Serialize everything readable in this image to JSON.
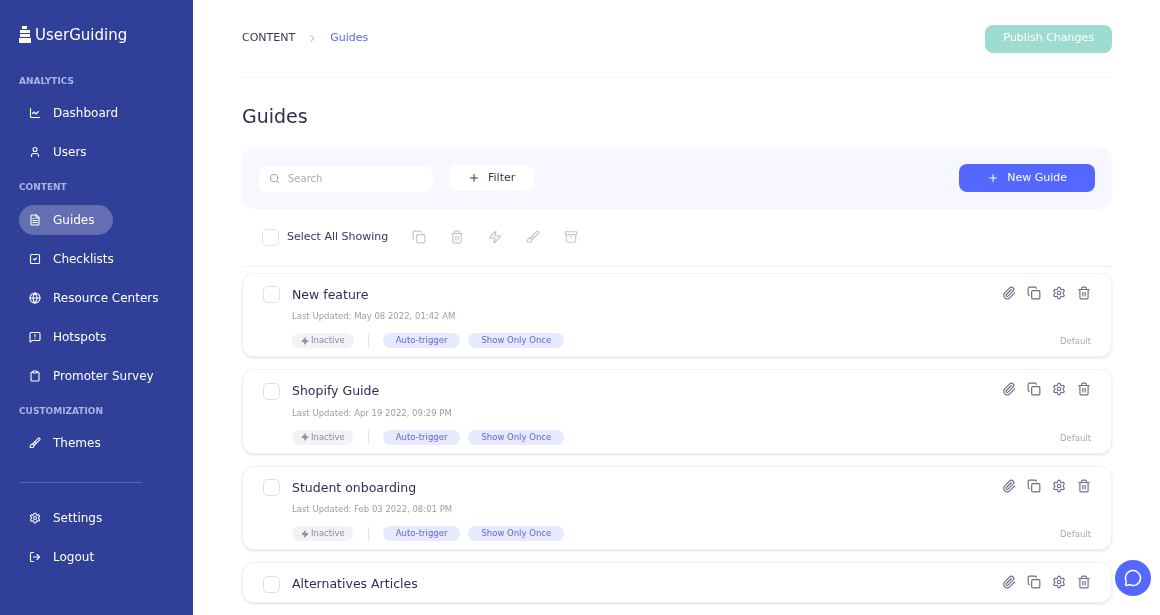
{
  "brand": "UserGuiding",
  "sidebar": {
    "sections": [
      {
        "title": "ANALYTICS",
        "items": [
          {
            "label": "Dashboard",
            "selected": false
          },
          {
            "label": "Users",
            "selected": false
          }
        ]
      },
      {
        "title": "CONTENT",
        "items": [
          {
            "label": "Guides",
            "selected": true
          },
          {
            "label": "Checklists",
            "selected": false
          },
          {
            "label": "Resource Centers",
            "selected": false
          },
          {
            "label": "Hotspots",
            "selected": false
          },
          {
            "label": "Promoter Survey",
            "selected": false
          }
        ]
      },
      {
        "title": "CUSTOMIZATION",
        "items": [
          {
            "label": "Themes",
            "selected": false
          }
        ]
      }
    ],
    "bottom_items": [
      {
        "label": "Settings",
        "selected": false
      },
      {
        "label": "Logout",
        "selected": false
      }
    ]
  },
  "breadcrumb": [
    "CONTENT",
    "Guides"
  ],
  "publish_button": {
    "label": "Publish Changes",
    "disabled": true
  },
  "page_title": "Guides",
  "search": {
    "placeholder": "Search"
  },
  "filter_button": "Filter",
  "new_button": "New Guide",
  "select_all": {
    "label": "Select All Showing",
    "checked": false
  },
  "guides": [
    {
      "name": "New feature",
      "updated": "Last Updated: May 08 2022, 01:42 AM",
      "status": "Inactive",
      "tags": [
        "Auto-trigger",
        "Show Only Once"
      ],
      "theme": "Default",
      "checked": false
    },
    {
      "name": "Shopify Guide",
      "updated": "Last Updated: Apr 19 2022, 09:29 PM",
      "status": "Inactive",
      "tags": [
        "Auto-trigger",
        "Show Only Once"
      ],
      "theme": "Default",
      "checked": false
    },
    {
      "name": "Student onboarding",
      "updated": "Last Updated: Feb 03 2022, 08:01 PM",
      "status": "Inactive",
      "tags": [
        "Auto-trigger",
        "Show Only Once"
      ],
      "theme": "Default",
      "checked": false
    },
    {
      "name": "Alternatives Articles",
      "checked": false
    }
  ]
}
